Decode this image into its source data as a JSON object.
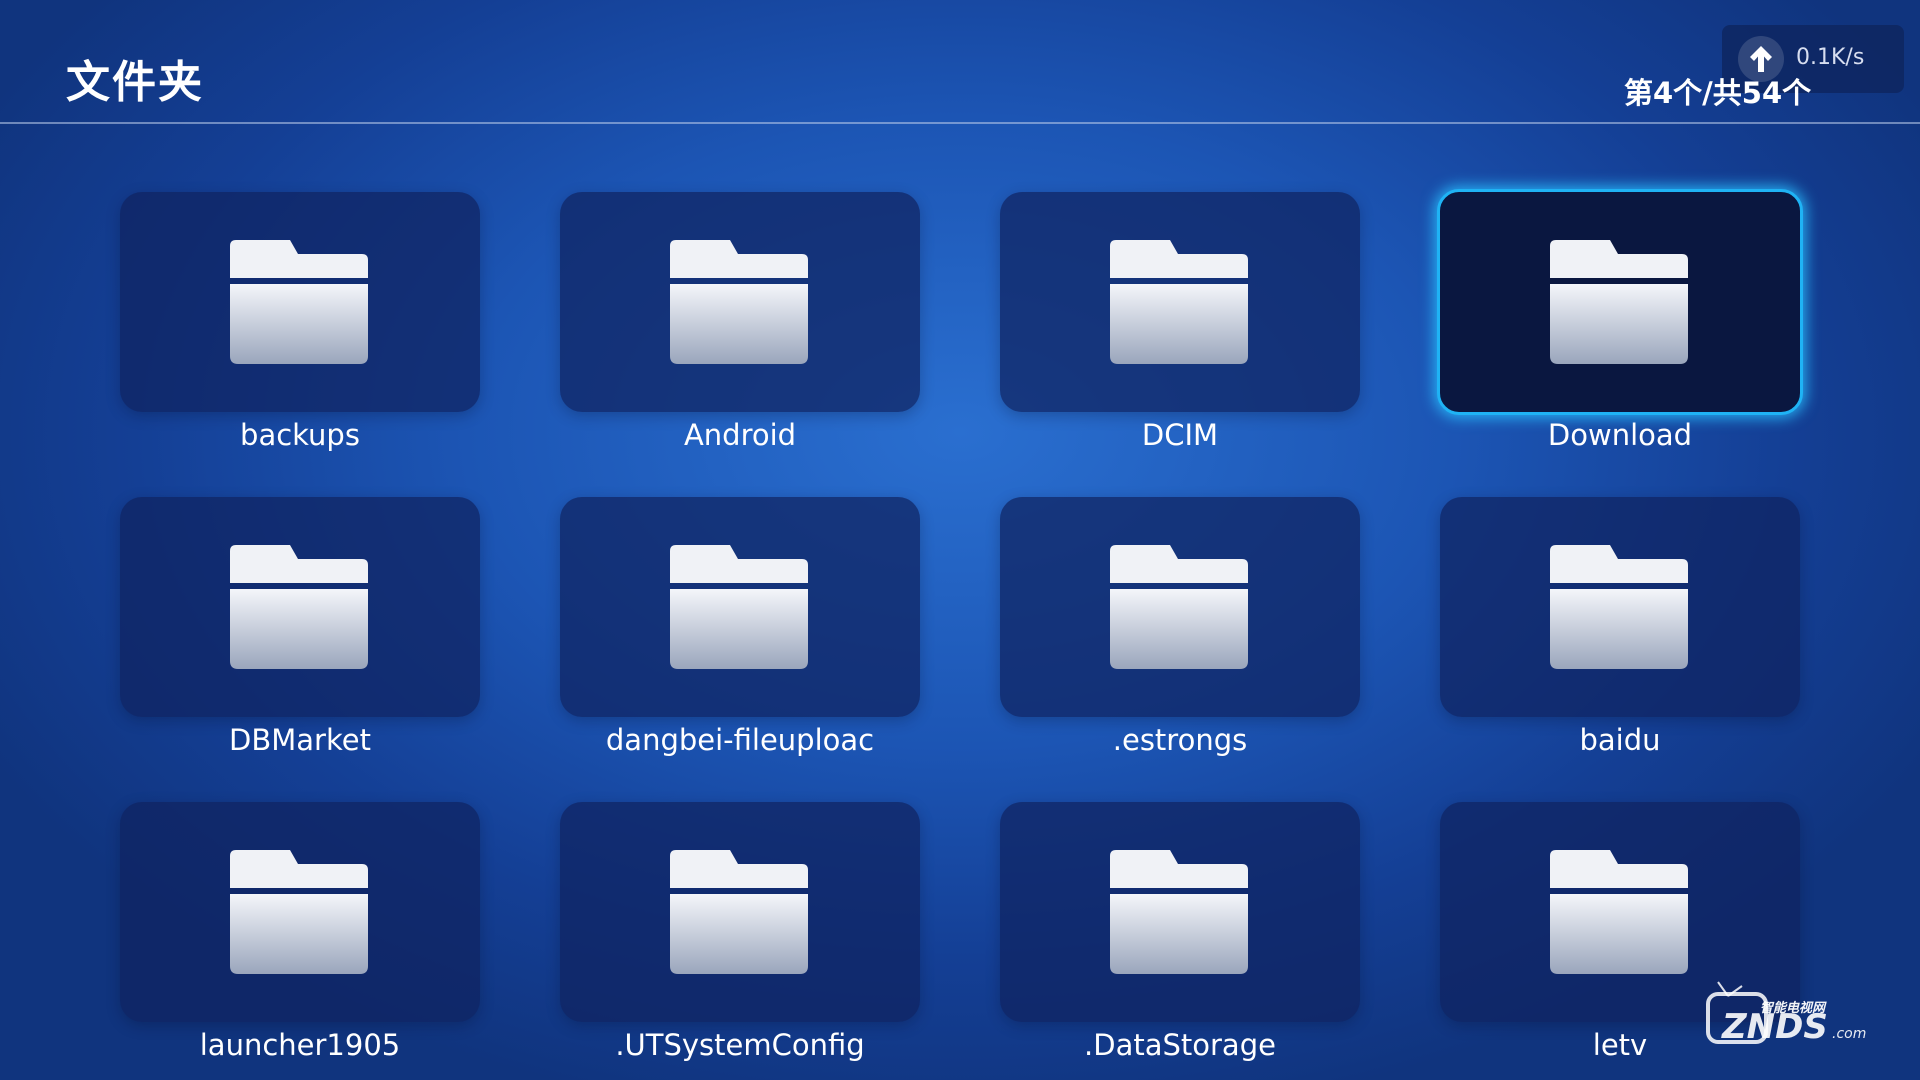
{
  "header": {
    "title": "文件夹",
    "position_text": "第4个/共54个"
  },
  "status": {
    "speed": "0.1K/s",
    "speed_icon": "upload-arrow-icon"
  },
  "folders": [
    {
      "name": "backups"
    },
    {
      "name": "Android"
    },
    {
      "name": "DCIM"
    },
    {
      "name": "Download",
      "focused": true
    },
    {
      "name": "DBMarket"
    },
    {
      "name": "dangbei-fileuploac"
    },
    {
      "name": ".estrongs"
    },
    {
      "name": "baidu"
    },
    {
      "name": "launcher1905"
    },
    {
      "name": ".UTSystemConfig"
    },
    {
      "name": ".DataStorage"
    },
    {
      "name": "letv"
    }
  ],
  "watermark": {
    "brand": "ZNDS",
    "suffix": ".com",
    "tagline": "智能电视网"
  },
  "colors": {
    "focus_border": "#1fb3f5",
    "tile_bg": "#0f235f",
    "focused_tile_bg": "#0a1740"
  }
}
